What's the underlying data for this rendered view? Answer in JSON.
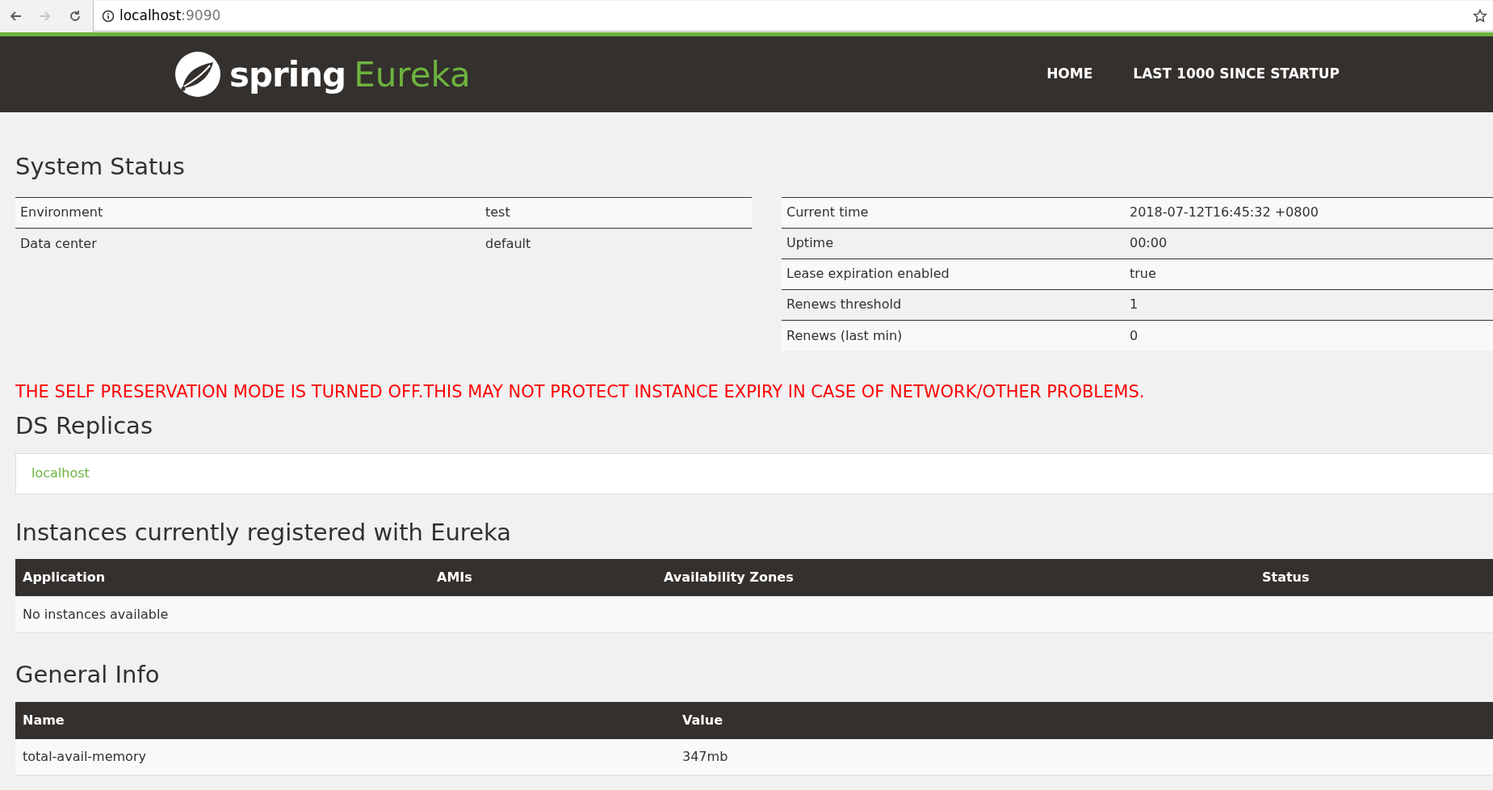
{
  "browser": {
    "nav_buttons": [
      {
        "kind": "back",
        "disabled": false
      },
      {
        "kind": "forward",
        "disabled": true
      },
      {
        "kind": "reload",
        "disabled": false
      }
    ],
    "url_host": "localhost",
    "url_port": ":9090"
  },
  "header": {
    "logo_word": "spring",
    "logo_product": "Eureka",
    "nav": [
      "HOME",
      "LAST 1000 SINCE STARTUP"
    ]
  },
  "system_status": {
    "title": "System Status",
    "left_rows": [
      {
        "label": "Environment",
        "value": "test"
      },
      {
        "label": "Data center",
        "value": "default"
      }
    ],
    "right_rows": [
      {
        "label": "Current time",
        "value": "2018-07-12T16:45:32 +0800"
      },
      {
        "label": "Uptime",
        "value": "00:00"
      },
      {
        "label": "Lease expiration enabled",
        "value": "true"
      },
      {
        "label": "Renews threshold",
        "value": "1"
      },
      {
        "label": "Renews (last min)",
        "value": "0"
      }
    ]
  },
  "warning": "THE SELF PRESERVATION MODE IS TURNED OFF.THIS MAY NOT PROTECT INSTANCE EXPIRY IN CASE OF NETWORK/OTHER PROBLEMS.",
  "ds_replicas": {
    "title": "DS Replicas",
    "items": [
      "localhost"
    ]
  },
  "instances": {
    "title": "Instances currently registered with Eureka",
    "columns": [
      "Application",
      "AMIs",
      "Availability Zones",
      "Status"
    ],
    "empty_text": "No instances available"
  },
  "general_info": {
    "title": "General Info",
    "columns": [
      "Name",
      "Value"
    ],
    "rows": [
      {
        "name": "total-avail-memory",
        "value": "347mb"
      }
    ]
  }
}
